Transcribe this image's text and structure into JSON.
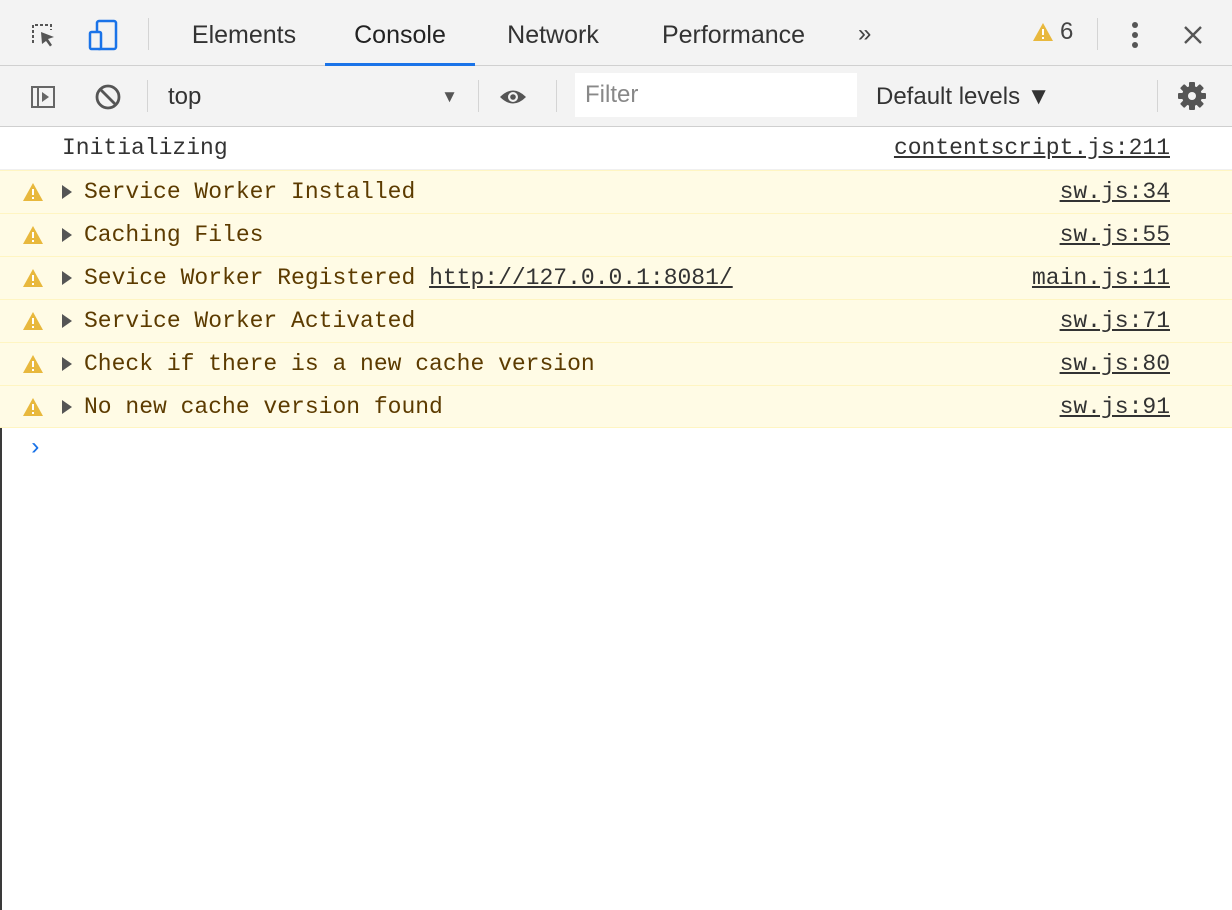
{
  "tabs": [
    {
      "label": "Elements"
    },
    {
      "label": "Console"
    },
    {
      "label": "Network"
    },
    {
      "label": "Performance"
    }
  ],
  "tabbar": {
    "more_tabs": "»",
    "warning_count": "6",
    "icons": [
      "inspect-element-icon",
      "device-toolbar-icon",
      "warning-icon",
      "kebab-menu-icon",
      "close-icon"
    ]
  },
  "toolbar": {
    "context": "top",
    "filter_placeholder": "Filter",
    "filter_value": "",
    "levels": "Default levels ▼",
    "icons": [
      "sidebar-toggle-icon",
      "clear-console-icon",
      "eye-icon",
      "settings-gear-icon"
    ]
  },
  "messages": [
    {
      "level": "log",
      "text": "Initializing",
      "source": "contentscript.js:211"
    },
    {
      "level": "warning",
      "text": "Service Worker Installed",
      "source": "sw.js:34"
    },
    {
      "level": "warning",
      "text": "Caching Files",
      "source": "sw.js:55"
    },
    {
      "level": "warning",
      "text": "Sevice Worker Registered ",
      "link": "http://127.0.0.1:8081/",
      "source": "main.js:11"
    },
    {
      "level": "warning",
      "text": "Service Worker Activated",
      "source": "sw.js:71"
    },
    {
      "level": "warning",
      "text": "Check if there is a new cache version",
      "source": "sw.js:80"
    },
    {
      "level": "warning",
      "text": "No new cache version found",
      "source": "sw.js:91"
    }
  ],
  "prompt": "›",
  "colors": {
    "accent": "#1a73e8",
    "warning_bg": "#fffbe5",
    "warning_icon": "#e8b83d"
  }
}
